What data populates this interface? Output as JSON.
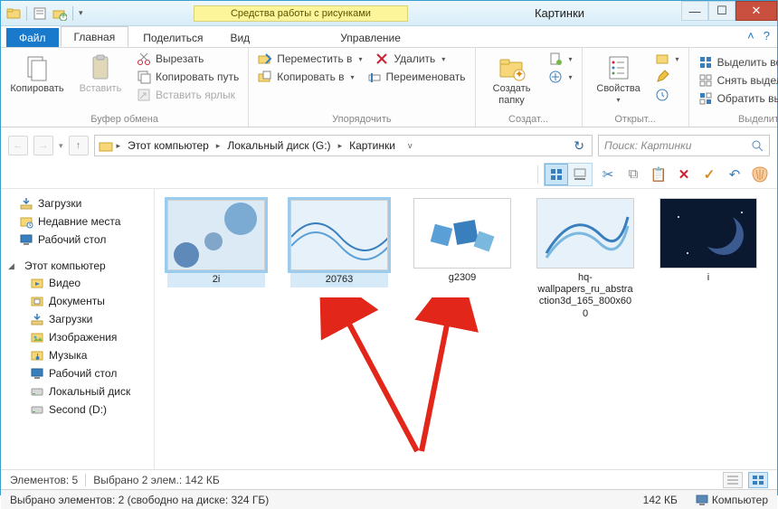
{
  "window": {
    "title": "Картинки",
    "context_tab_title": "Средства работы с рисунками"
  },
  "tabs": {
    "file": "Файл",
    "home": "Главная",
    "share": "Поделиться",
    "view": "Вид",
    "manage": "Управление"
  },
  "ribbon": {
    "clipboard": {
      "copy": "Копировать",
      "paste": "Вставить",
      "cut": "Вырезать",
      "copy_path": "Копировать путь",
      "paste_shortcut": "Вставить ярлык",
      "label": "Буфер обмена"
    },
    "organize": {
      "move_to": "Переместить в",
      "copy_to": "Копировать в",
      "delete": "Удалить",
      "rename": "Переименовать",
      "label": "Упорядочить"
    },
    "new": {
      "new_folder": "Создать папку",
      "label": "Создат..."
    },
    "open": {
      "properties": "Свойства",
      "label": "Открыт..."
    },
    "select": {
      "select_all": "Выделить все",
      "select_none": "Снять выделение",
      "invert": "Обратить выделение",
      "label": "Выделить"
    }
  },
  "breadcrumb": {
    "root": "Этот компьютер",
    "drive": "Локальный диск (G:)",
    "folder": "Картинки"
  },
  "search": {
    "placeholder": "Поиск: Картинки"
  },
  "tree": {
    "quick": [
      {
        "label": "Загрузки",
        "icon": "downloads"
      },
      {
        "label": "Недавние места",
        "icon": "recent"
      },
      {
        "label": "Рабочий стол",
        "icon": "desktop"
      }
    ],
    "computer_header": "Этот компьютер",
    "computer": [
      {
        "label": "Видео",
        "icon": "video"
      },
      {
        "label": "Документы",
        "icon": "documents"
      },
      {
        "label": "Загрузки",
        "icon": "downloads"
      },
      {
        "label": "Изображения",
        "icon": "pictures"
      },
      {
        "label": "Музыка",
        "icon": "music"
      },
      {
        "label": "Рабочий стол",
        "icon": "desktop"
      },
      {
        "label": "Локальный диск",
        "icon": "disk"
      },
      {
        "label": "Second (D:)",
        "icon": "disk"
      }
    ]
  },
  "files": [
    {
      "name": "2i",
      "selected": true
    },
    {
      "name": "20763",
      "selected": true
    },
    {
      "name": "g2309",
      "selected": false
    },
    {
      "name": "hq-wallpapers_ru_abstraction3d_165_800x600",
      "selected": false
    },
    {
      "name": "i",
      "selected": false
    }
  ],
  "status1": {
    "count": "Элементов: 5",
    "selected": "Выбрано 2 элем.: 142 КБ"
  },
  "status2": {
    "line": "Выбрано элементов: 2 (свободно на диске: 324 ГБ)",
    "size": "142 КБ",
    "computer": "Компьютер"
  }
}
